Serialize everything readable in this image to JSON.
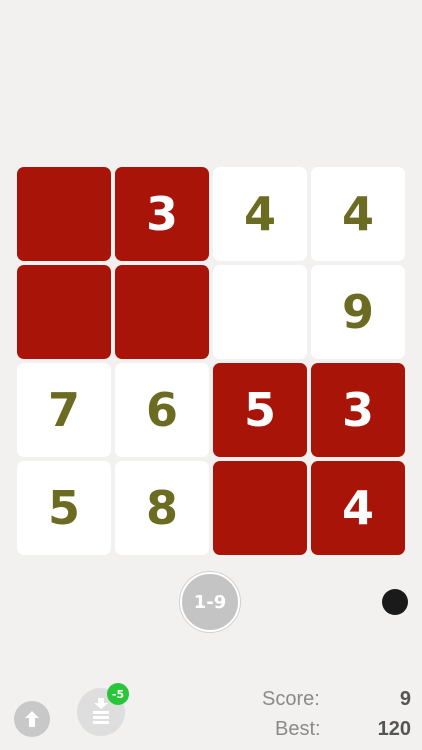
{
  "board": {
    "rows": [
      [
        {
          "value": "",
          "color": "red"
        },
        {
          "value": "3",
          "color": "red"
        },
        {
          "value": "4",
          "color": "white"
        },
        {
          "value": "4",
          "color": "white"
        }
      ],
      [
        {
          "value": "",
          "color": "red"
        },
        {
          "value": "",
          "color": "red"
        },
        {
          "value": "",
          "color": "white"
        },
        {
          "value": "9",
          "color": "white"
        }
      ],
      [
        {
          "value": "7",
          "color": "white"
        },
        {
          "value": "6",
          "color": "white"
        },
        {
          "value": "5",
          "color": "red"
        },
        {
          "value": "3",
          "color": "red"
        }
      ],
      [
        {
          "value": "5",
          "color": "white"
        },
        {
          "value": "8",
          "color": "white"
        },
        {
          "value": "",
          "color": "red"
        },
        {
          "value": "4",
          "color": "red"
        }
      ]
    ]
  },
  "controls": {
    "range_label": "1-9",
    "bonus_badge": "-5",
    "up_icon": "arrow-up-icon",
    "stack_icon": "stack-icon"
  },
  "scoreboard": {
    "score_label": "Score:",
    "score_value": "9",
    "best_label": "Best:",
    "best_value": "120"
  },
  "colors": {
    "tile_red": "#a81407",
    "tile_white": "#ffffff",
    "digit_on_white": "#6b6b22",
    "background": "#f2f1f0",
    "badge_green": "#29c63a"
  }
}
